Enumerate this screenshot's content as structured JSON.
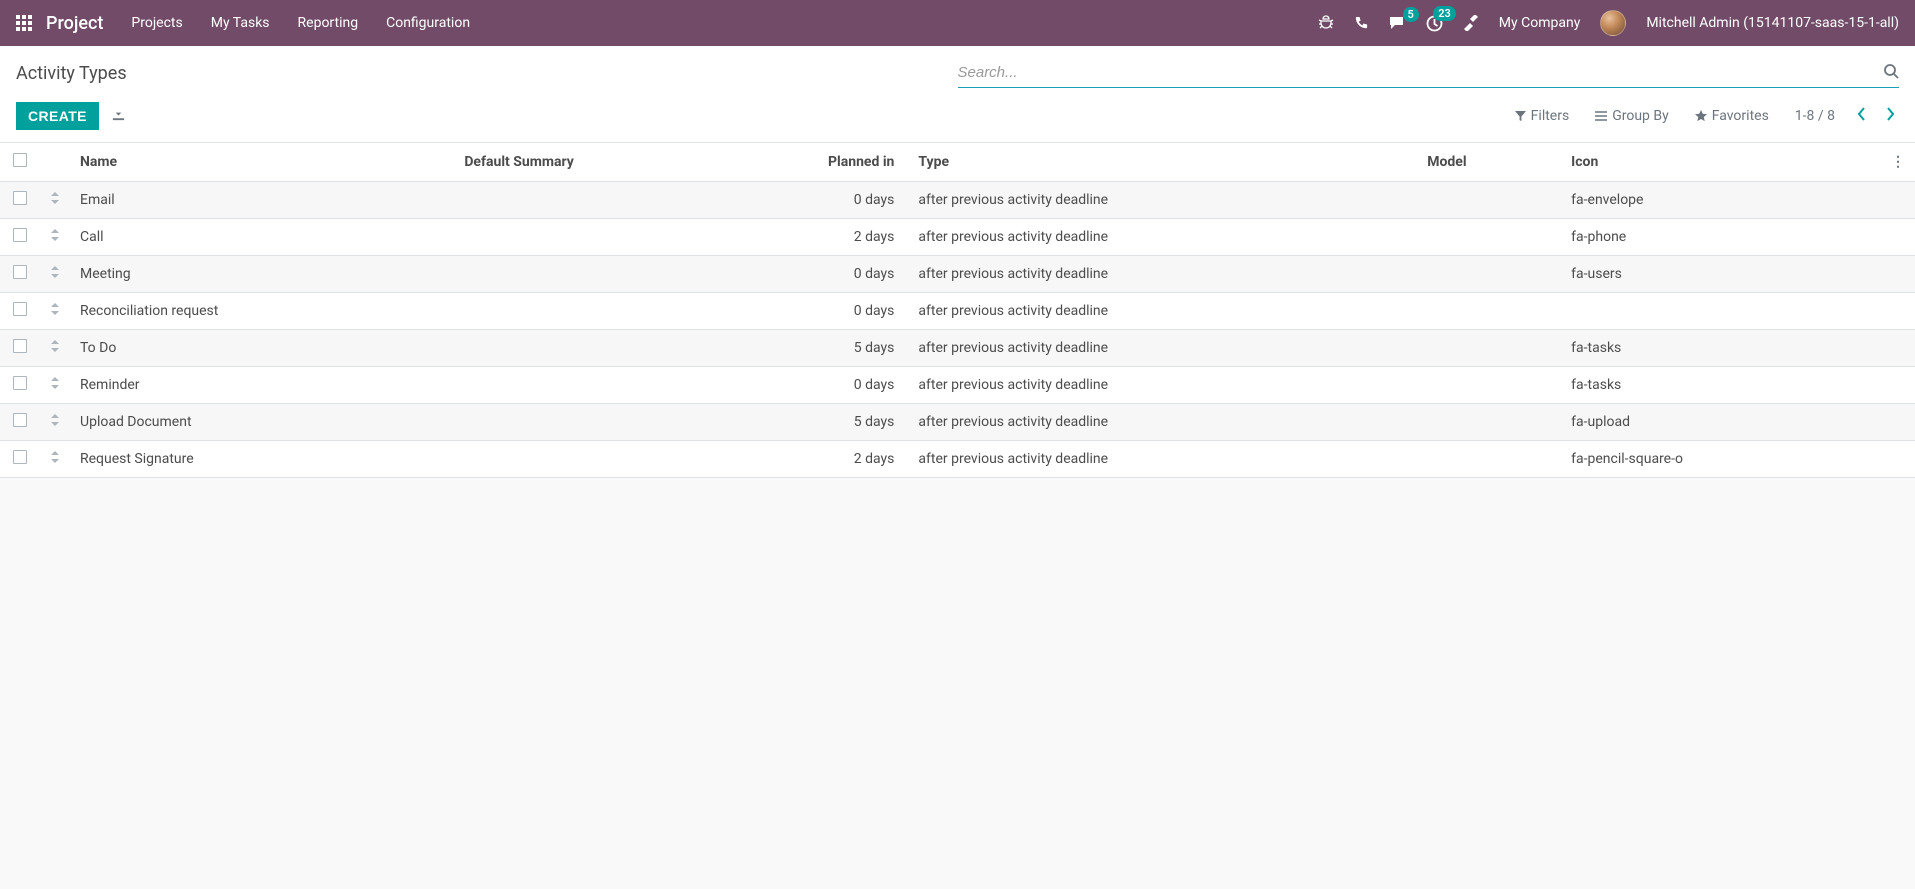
{
  "nav": {
    "brand": "Project",
    "links": [
      "Projects",
      "My Tasks",
      "Reporting",
      "Configuration"
    ],
    "messages_badge": "5",
    "activities_badge": "23",
    "company": "My Company",
    "user": "Mitchell Admin (15141107-saas-15-1-all)"
  },
  "page": {
    "title": "Activity Types",
    "create_label": "CREATE",
    "search_placeholder": "Search...",
    "filters_label": "Filters",
    "groupby_label": "Group By",
    "favorites_label": "Favorites",
    "pager": "1-8 / 8"
  },
  "table": {
    "headers": {
      "name": "Name",
      "default_summary": "Default Summary",
      "planned_in": "Planned in",
      "type": "Type",
      "model": "Model",
      "icon": "Icon"
    },
    "rows": [
      {
        "name": "Email",
        "default_summary": "",
        "planned_in": "0 days",
        "type": "after previous activity deadline",
        "model": "",
        "icon": "fa-envelope"
      },
      {
        "name": "Call",
        "default_summary": "",
        "planned_in": "2 days",
        "type": "after previous activity deadline",
        "model": "",
        "icon": "fa-phone"
      },
      {
        "name": "Meeting",
        "default_summary": "",
        "planned_in": "0 days",
        "type": "after previous activity deadline",
        "model": "",
        "icon": "fa-users"
      },
      {
        "name": "Reconciliation request",
        "default_summary": "",
        "planned_in": "0 days",
        "type": "after previous activity deadline",
        "model": "",
        "icon": ""
      },
      {
        "name": "To Do",
        "default_summary": "",
        "planned_in": "5 days",
        "type": "after previous activity deadline",
        "model": "",
        "icon": "fa-tasks"
      },
      {
        "name": "Reminder",
        "default_summary": "",
        "planned_in": "0 days",
        "type": "after previous activity deadline",
        "model": "",
        "icon": "fa-tasks"
      },
      {
        "name": "Upload Document",
        "default_summary": "",
        "planned_in": "5 days",
        "type": "after previous activity deadline",
        "model": "",
        "icon": "fa-upload"
      },
      {
        "name": "Request Signature",
        "default_summary": "",
        "planned_in": "2 days",
        "type": "after previous activity deadline",
        "model": "",
        "icon": "fa-pencil-square-o"
      }
    ]
  }
}
